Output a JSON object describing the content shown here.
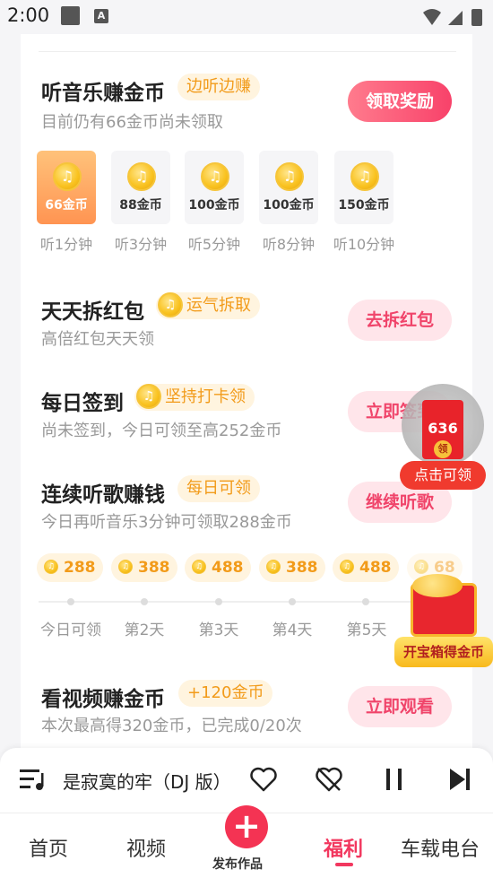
{
  "status_bar": {
    "time": "2:00",
    "notification_icon": "A"
  },
  "music_section": {
    "title": "听音乐赚金币",
    "tag": "边听边赚",
    "subtitle": "目前仍有66金币尚未领取",
    "button": "领取奖励",
    "rewards": [
      {
        "amount": "66金币",
        "label": "听1分钟",
        "active": true
      },
      {
        "amount": "88金币",
        "label": "听3分钟",
        "active": false
      },
      {
        "amount": "100金币",
        "label": "听5分钟",
        "active": false
      },
      {
        "amount": "100金币",
        "label": "听8分钟",
        "active": false
      },
      {
        "amount": "150金币",
        "label": "听10分钟",
        "active": false
      }
    ]
  },
  "redpacket": {
    "title": "天天拆红包",
    "tag": "运气拆取",
    "subtitle": "高倍红包天天领",
    "button": "去拆红包"
  },
  "checkin": {
    "title": "每日签到",
    "tag": "坚持打卡领",
    "subtitle": "尚未签到，今日可领至高252金币",
    "button": "立即签到"
  },
  "streak": {
    "title": "连续听歌赚钱",
    "tag": "每日可领",
    "subtitle": "今日再听音乐3分钟可领取288金币",
    "button": "继续听歌",
    "days": [
      {
        "coins": "288",
        "label": "今日可领"
      },
      {
        "coins": "388",
        "label": "第2天"
      },
      {
        "coins": "488",
        "label": "第3天"
      },
      {
        "coins": "388",
        "label": "第4天"
      },
      {
        "coins": "488",
        "label": "第5天"
      },
      {
        "coins": "68",
        "label": ""
      }
    ]
  },
  "video": {
    "title": "看视频赚金币",
    "tag": "+120金币",
    "subtitle": "本次最高得320金币，已完成0/20次",
    "button": "立即观看"
  },
  "float_redpacket": {
    "amount": "636",
    "badge": "领",
    "label": "点击可领"
  },
  "float_chest": {
    "label": "开宝箱得金币"
  },
  "player": {
    "song": "是寂寞的牢（DJ 版）"
  },
  "nav": {
    "items": [
      "首页",
      "视频",
      "福利",
      "车载电台"
    ],
    "publish": "发布作品",
    "active": "福利"
  },
  "colors": {
    "accent": "#f2385f",
    "coin_gold": "#f9c21f",
    "tag_bg": "#fff4df",
    "tag_text": "#f29b1a"
  }
}
